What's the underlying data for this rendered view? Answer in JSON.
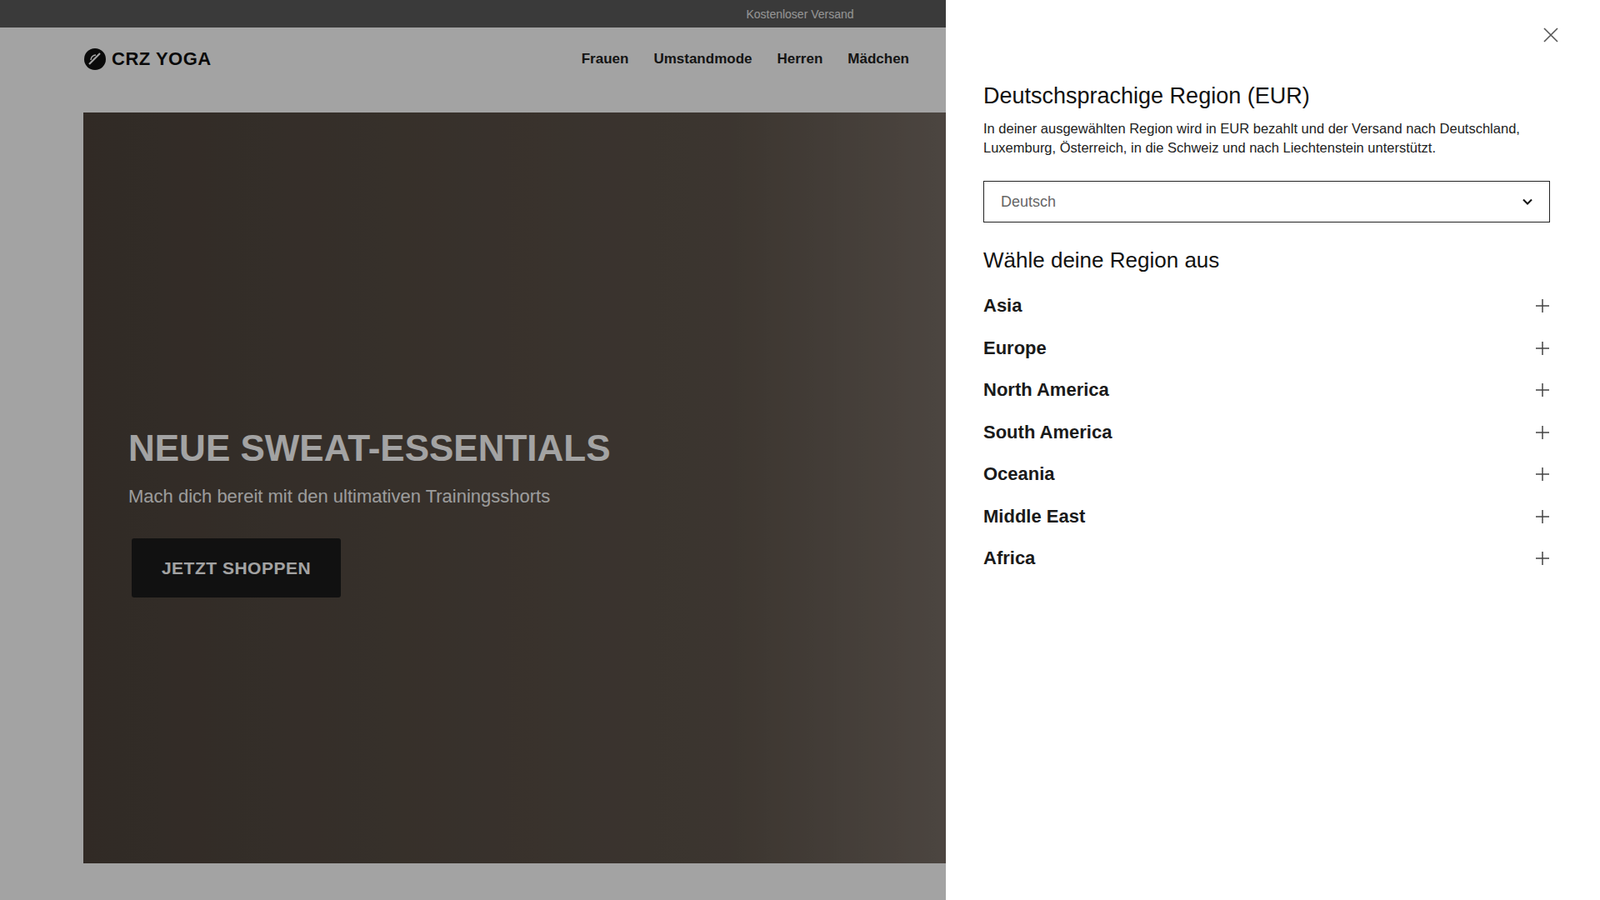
{
  "topbar": {
    "text": "Kostenloser Versand"
  },
  "header": {
    "logo": "CRZ YOGA",
    "nav": [
      "Frauen",
      "Umstandmode",
      "Herren",
      "Mädchen"
    ]
  },
  "hero": {
    "title": "NEUE SWEAT-ESSENTIALS",
    "subtitle": "Mach dich bereit mit den ultimativen Trainingsshorts",
    "button": "JETZT SHOPPEN"
  },
  "panel": {
    "title": "Deutschsprachige Region (EUR)",
    "description": "In deiner ausgewählten Region wird in EUR bezahlt und der Versand nach Deutschland, Luxemburg, Österreich, in die Schweiz und nach Liechtenstein unterstützt.",
    "language": "Deutsch",
    "region_heading": "Wähle deine Region aus",
    "regions": [
      {
        "label": "Asia",
        "expanded": false
      },
      {
        "label": "Europe",
        "expanded": false
      },
      {
        "label": "North America",
        "expanded": false
      },
      {
        "label": "South America",
        "expanded": false
      },
      {
        "label": "Oceania",
        "expanded": false
      },
      {
        "label": "Middle East",
        "expanded": false
      },
      {
        "label": "Africa",
        "expanded": false
      }
    ]
  }
}
